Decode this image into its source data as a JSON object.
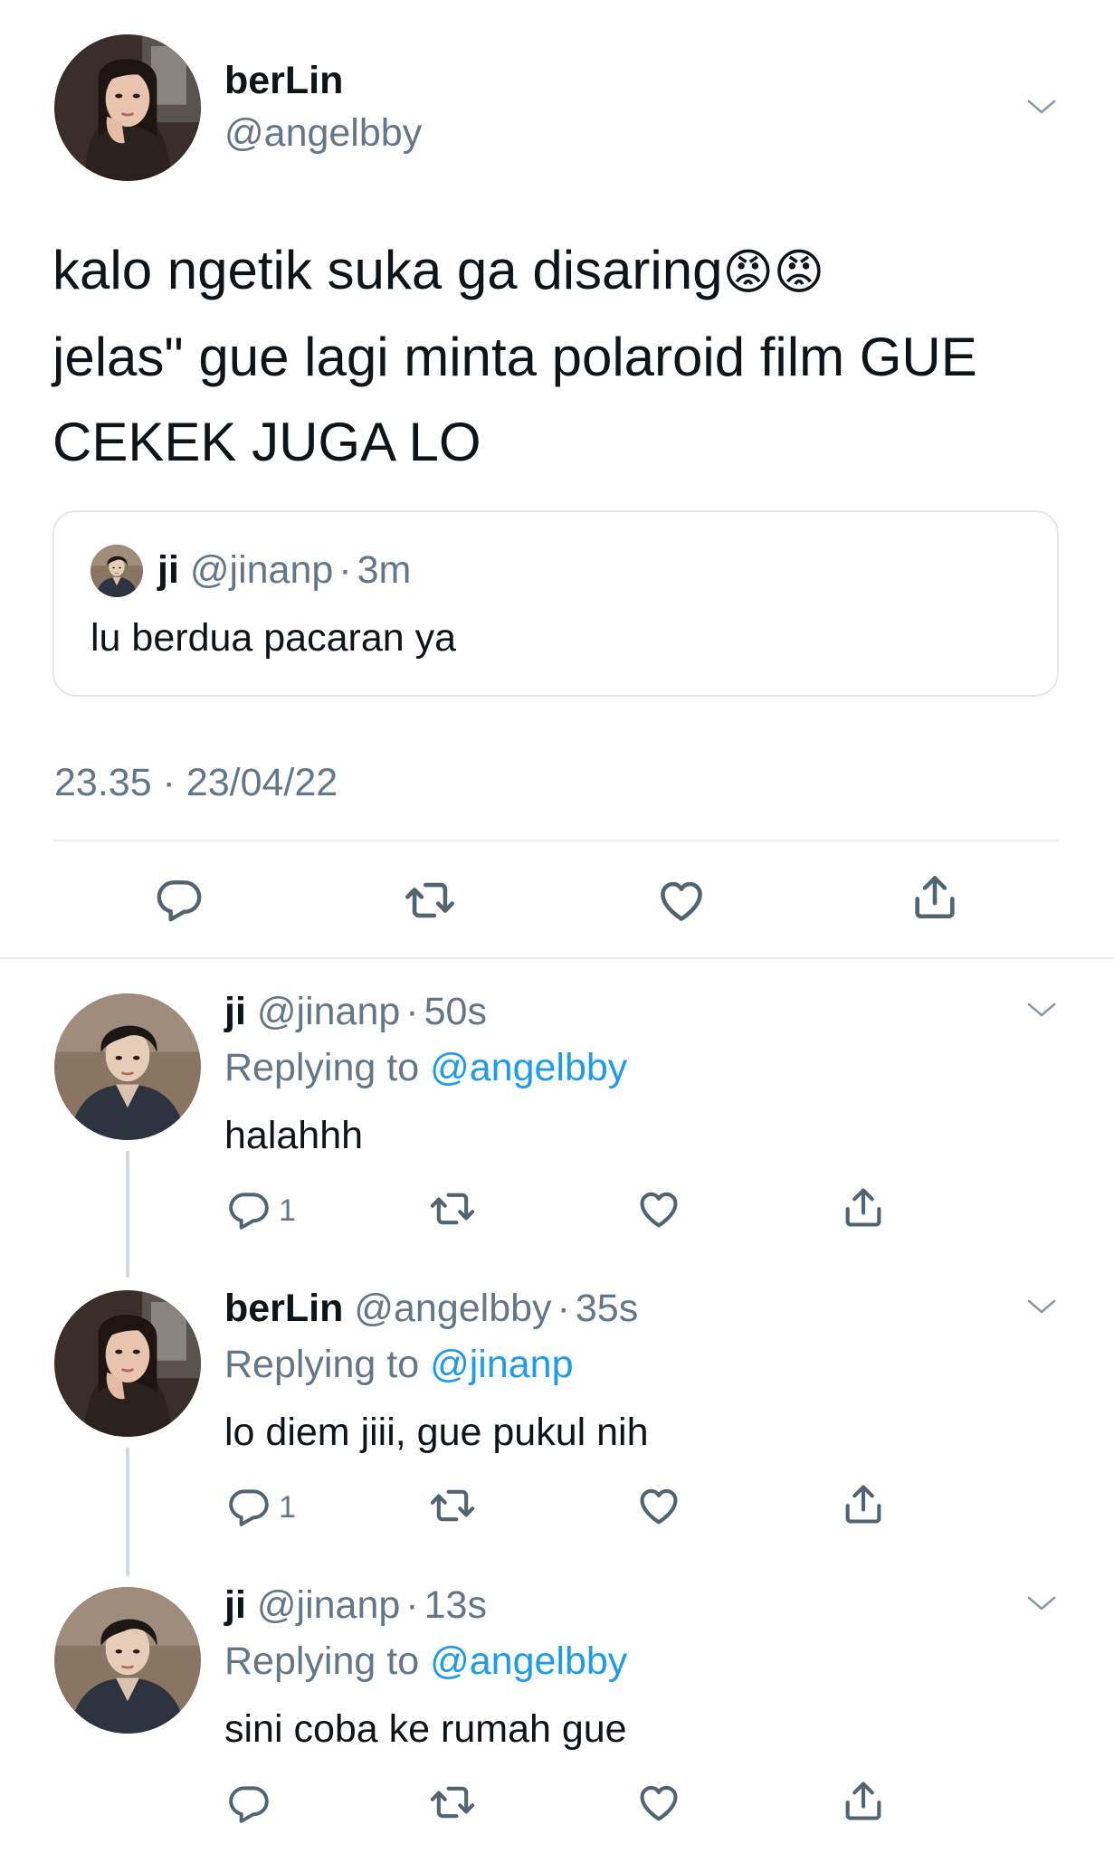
{
  "main_tweet": {
    "display_name": "berLin",
    "handle": "@angelbby",
    "text_line1": "kalo ngetik suka ga disaring",
    "emoji": "😡😡",
    "text_line2": "jelas\" gue lagi minta polaroid film GUE",
    "text_line3": "CEKEK JUGA LO",
    "quote": {
      "display_name": "ji",
      "handle": "@jinanp",
      "separator": "·",
      "time": "3m",
      "text": "lu berdua pacaran ya"
    },
    "timestamp": "23.35 · 23/04/22"
  },
  "replies": [
    {
      "display_name": "ji",
      "handle": "@jinanp",
      "separator": "·",
      "time": "50s",
      "replying_prefix": "Replying to",
      "replying_to": "@angelbby",
      "text": "halahhh",
      "reply_count": "1"
    },
    {
      "display_name": "berLin",
      "handle": "@angelbby",
      "separator": "·",
      "time": "35s",
      "replying_prefix": "Replying to",
      "replying_to": "@jinanp",
      "text": "lo diem jiii, gue pukul nih",
      "reply_count": "1"
    },
    {
      "display_name": "ji",
      "handle": "@jinanp",
      "separator": "·",
      "time": "13s",
      "replying_prefix": "Replying to",
      "replying_to": "@angelbby",
      "text": "sini coba ke rumah gue",
      "reply_count": ""
    }
  ],
  "icons": {
    "reply": "speech-bubble-icon",
    "retweet": "retweet-arrows-icon",
    "like": "heart-outline-icon",
    "share": "share-upload-icon",
    "menu": "chevron-down-icon"
  },
  "colors": {
    "link": "#1d9bf0",
    "muted": "#657786",
    "text": "#0f1419",
    "icon": "#536471",
    "border": "#e1e8ed"
  }
}
